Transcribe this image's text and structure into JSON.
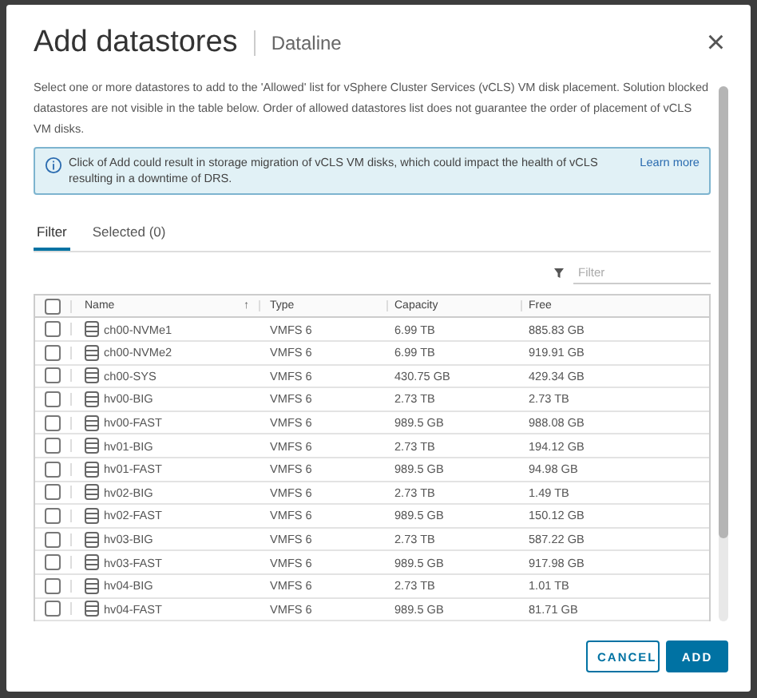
{
  "dialog": {
    "title": "Add datastores",
    "subtitle": "Dataline",
    "close": "×"
  },
  "description": "Select one or more datastores to add to the 'Allowed' list for vSphere Cluster Services (vCLS) VM disk placement. Solution blocked datastores are not visible in the table below. Order of allowed datastores list does not guarantee the order of placement of vCLS VM disks.",
  "alert": {
    "text": "Click of Add could result in storage migration of vCLS VM disks, which could impact the health of vCLS resulting in a downtime of DRS.",
    "link": "Learn more"
  },
  "tabs": [
    {
      "label": "Filter",
      "selected": true
    },
    {
      "label": "Selected (0)",
      "selected": false
    }
  ],
  "filter": {
    "placeholder": "Filter"
  },
  "table": {
    "columns": [
      {
        "label": "Name",
        "sort": "↑"
      },
      {
        "label": "Type"
      },
      {
        "label": "Capacity"
      },
      {
        "label": "Free"
      }
    ],
    "select_all_checked": false,
    "rows": [
      {
        "name": "ch00-NVMe1",
        "type": "VMFS 6",
        "capacity": "6.99 TB",
        "free": "885.83 GB",
        "checked": false
      },
      {
        "name": "ch00-NVMe2",
        "type": "VMFS 6",
        "capacity": "6.99 TB",
        "free": "919.91 GB",
        "checked": false
      },
      {
        "name": "ch00-SYS",
        "type": "VMFS 6",
        "capacity": "430.75 GB",
        "free": "429.34 GB",
        "checked": false
      },
      {
        "name": "hv00-BIG",
        "type": "VMFS 6",
        "capacity": "2.73 TB",
        "free": "2.73 TB",
        "checked": false
      },
      {
        "name": "hv00-FAST",
        "type": "VMFS 6",
        "capacity": "989.5 GB",
        "free": "988.08 GB",
        "checked": false
      },
      {
        "name": "hv01-BIG",
        "type": "VMFS 6",
        "capacity": "2.73 TB",
        "free": "194.12 GB",
        "checked": false
      },
      {
        "name": "hv01-FAST",
        "type": "VMFS 6",
        "capacity": "989.5 GB",
        "free": "94.98 GB",
        "checked": false
      },
      {
        "name": "hv02-BIG",
        "type": "VMFS 6",
        "capacity": "2.73 TB",
        "free": "1.49 TB",
        "checked": false
      },
      {
        "name": "hv02-FAST",
        "type": "VMFS 6",
        "capacity": "989.5 GB",
        "free": "150.12 GB",
        "checked": false
      },
      {
        "name": "hv03-BIG",
        "type": "VMFS 6",
        "capacity": "2.73 TB",
        "free": "587.22 GB",
        "checked": false
      },
      {
        "name": "hv03-FAST",
        "type": "VMFS 6",
        "capacity": "989.5 GB",
        "free": "917.98 GB",
        "checked": false
      },
      {
        "name": "hv04-BIG",
        "type": "VMFS 6",
        "capacity": "2.73 TB",
        "free": "1.01 TB",
        "checked": false
      },
      {
        "name": "hv04-FAST",
        "type": "VMFS 6",
        "capacity": "989.5 GB",
        "free": "81.71 GB",
        "checked": false
      }
    ]
  },
  "buttons": [
    {
      "label": "CANCEL",
      "kind": "secondary"
    },
    {
      "label": "ADD",
      "kind": "primary"
    }
  ]
}
